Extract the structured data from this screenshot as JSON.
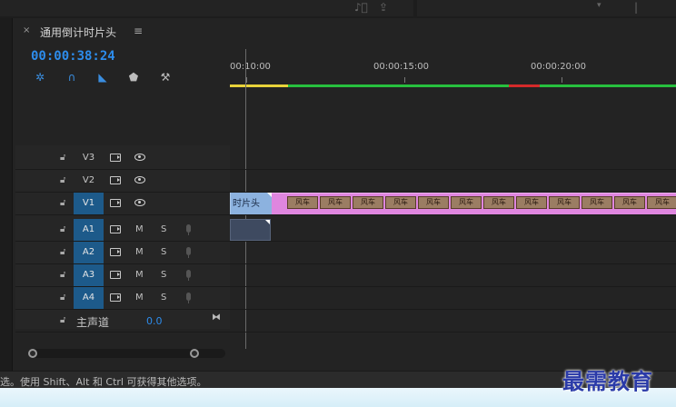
{
  "panel": {
    "close_glyph": "×",
    "title": "通用倒计时片头",
    "menu_glyph": "≡",
    "timecode": "00:00:38:24"
  },
  "toolbar": {
    "tools": [
      "insert-nest-icon",
      "snap-magnet-icon",
      "linked-selection-icon",
      "add-marker-icon",
      "settings-wrench-icon"
    ]
  },
  "ruler": {
    "labels": [
      "00:10:00",
      "00:00:15:00",
      "00:00:20:00"
    ]
  },
  "render_bar_colors": {
    "yellow": "#e8d23a",
    "green": "#27c03e",
    "red": "#d42a2a"
  },
  "tracks": {
    "video": [
      {
        "name": "V3",
        "targeted": false
      },
      {
        "name": "V2",
        "targeted": false
      },
      {
        "name": "V1",
        "targeted": true
      }
    ],
    "audio": [
      {
        "name": "A1",
        "targeted": true,
        "m": "M",
        "s": "S"
      },
      {
        "name": "A2",
        "targeted": true,
        "m": "M",
        "s": "S"
      },
      {
        "name": "A3",
        "targeted": true,
        "m": "M",
        "s": "S"
      },
      {
        "name": "A4",
        "targeted": true,
        "m": "M",
        "s": "S"
      }
    ],
    "master": {
      "label": "主声道",
      "value": "0.0"
    }
  },
  "clips": {
    "title_clip_label": "时片头",
    "video_thumb_label": "风车",
    "clip_colors": {
      "title": "#8cb2df",
      "video": "#df86df",
      "audio": "#3e4a60"
    }
  },
  "status_bar": {
    "text": "选。使用 Shift、Alt 和 Ctrl 可获得其他选项。"
  },
  "watermark": "最需教育"
}
